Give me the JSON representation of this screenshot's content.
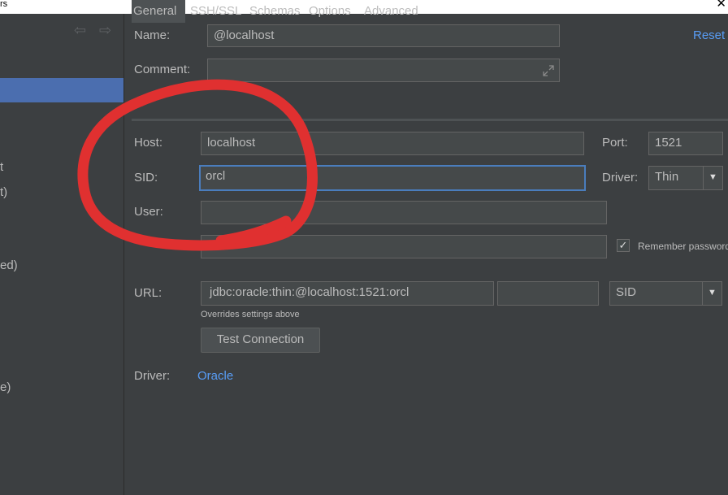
{
  "window": {
    "title_fragment": "rs",
    "close_glyph": "✕"
  },
  "sidebar": {
    "fragments": [
      "t",
      "t)",
      "ed)",
      "e)"
    ]
  },
  "form": {
    "name_label": "Name:",
    "name_value": "@localhost",
    "reset_label": "Reset",
    "comment_label": "Comment:",
    "comment_value": "",
    "host_label": "Host:",
    "host_value": "localhost",
    "port_label": "Port:",
    "port_value": "1521",
    "sid_label": "SID:",
    "sid_value": "orcl",
    "driver_label": "Driver:",
    "driver_value": "Thin",
    "user_label": "User:",
    "user_value": "",
    "password_value": "",
    "remember_password_label": "Remember password",
    "remember_password_checked": true,
    "url_label": "URL:",
    "url_value": "jdbc:oracle:thin:@localhost:1521:orcl",
    "url_extra_value": "",
    "url_type_value": "SID",
    "overrides_note": "Overrides settings above",
    "test_connection_label": "Test Connection",
    "driver_link_label": "Driver:",
    "driver_link_value": "Oracle"
  },
  "tabs": [
    {
      "label": "General",
      "active": true
    },
    {
      "label": "SSH/SSL",
      "active": false
    },
    {
      "label": "Schemas",
      "active": false
    },
    {
      "label": "Options",
      "active": false
    },
    {
      "label": "Advanced",
      "active": false
    }
  ],
  "icons": {
    "back": "arrow-left-icon",
    "forward": "arrow-right-icon",
    "expand": "expand-icon",
    "dropdown": "chevron-down-icon",
    "check": "checkmark-icon"
  },
  "colors": {
    "background": "#3c3f41",
    "selection": "#4b6eaf",
    "link": "#589df6",
    "annotation": "#e03030"
  }
}
